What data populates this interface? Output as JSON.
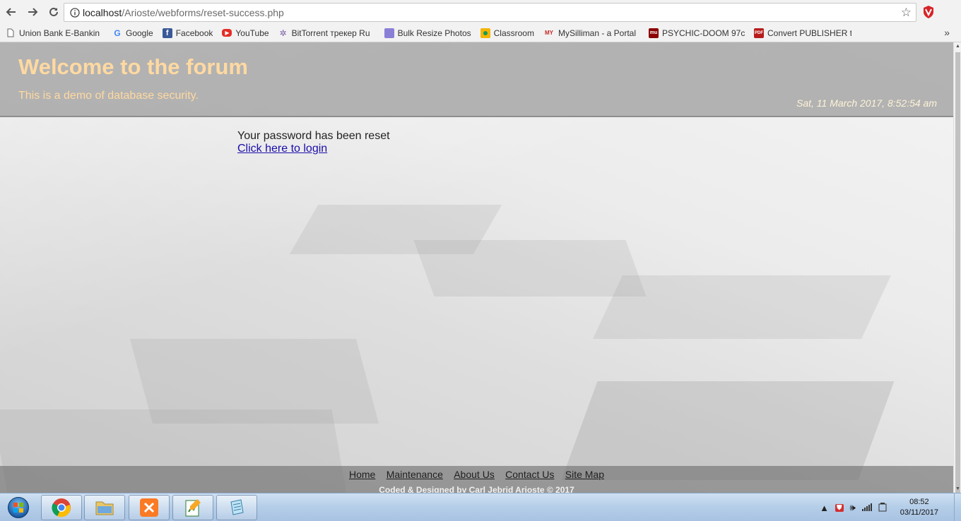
{
  "browser": {
    "url_host": "localhost",
    "url_path": "/Arioste/webforms/reset-success.php",
    "bookmarks": [
      {
        "label": "Union Bank E-Bankin",
        "icon": "page-icon",
        "color": "#ffffff"
      },
      {
        "label": "Google",
        "icon": "google-icon",
        "color": "#4285f4"
      },
      {
        "label": "Facebook",
        "icon": "facebook-icon",
        "color": "#3b5998"
      },
      {
        "label": "YouTube",
        "icon": "youtube-icon",
        "color": "#e52d27"
      },
      {
        "label": "BitTorrent трекер Ru",
        "icon": "bittorrent-icon",
        "color": "#7a5aa8"
      },
      {
        "label": "Bulk Resize Photos",
        "icon": "bulk-resize-icon",
        "color": "#8a7fd6"
      },
      {
        "label": "Classroom",
        "icon": "classroom-icon",
        "color": "#f4b400"
      },
      {
        "label": "MySilliman - a Portal",
        "icon": "mysilliman-icon",
        "color": "#c62828"
      },
      {
        "label": "PSYCHIC-DOOM 97c",
        "icon": "mu-icon",
        "color": "#8b0000"
      },
      {
        "label": "Convert PUBLISHER t",
        "icon": "pdf-icon",
        "color": "#b71c1c"
      }
    ],
    "more_label": "»"
  },
  "site": {
    "title": "Welcome to the forum",
    "subtitle": "This is a demo of database security.",
    "datetime": "Sat, 11 March 2017, 8:52:54 am",
    "message": "Your password has been reset",
    "login_link": "Click here to login",
    "footer_links": [
      "Home",
      "Maintenance",
      "About Us",
      "Contact Us",
      "Site Map"
    ],
    "footer_credit": "Coded & Designed by Carl Jebrid Arioste © 2017"
  },
  "taskbar": {
    "apps": [
      {
        "name": "chrome-app",
        "icon": "chrome-icon"
      },
      {
        "name": "explorer-app",
        "icon": "folder-icon"
      },
      {
        "name": "xampp-app",
        "icon": "xampp-icon"
      },
      {
        "name": "notepad-app",
        "icon": "notepad-icon"
      },
      {
        "name": "editor-app",
        "icon": "notebook-icon"
      }
    ],
    "time": "08:52",
    "date": "03/11/2017"
  }
}
